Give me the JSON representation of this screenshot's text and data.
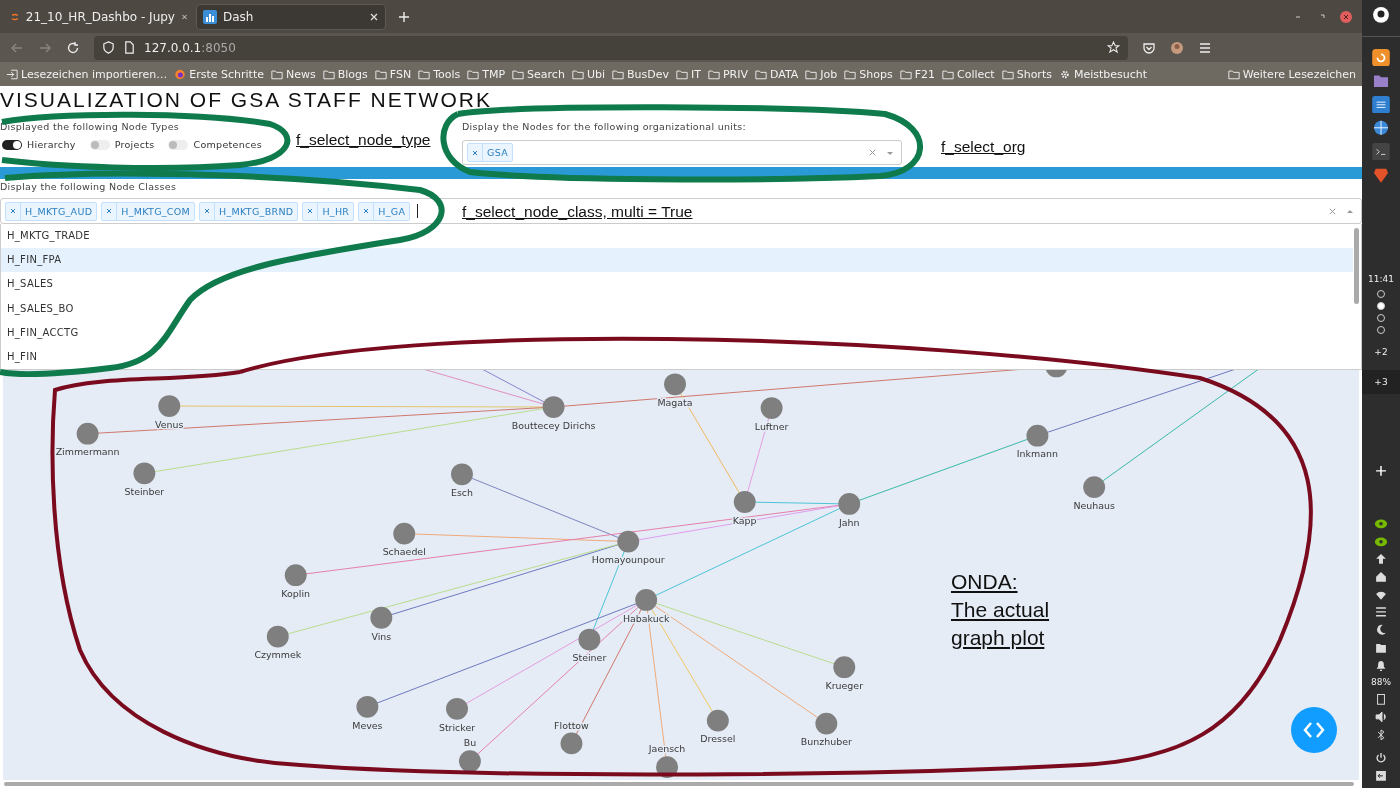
{
  "browser": {
    "tabs": [
      {
        "title": "21_10_HR_Dashbo - Jupy",
        "kind": "jupyter",
        "selected": false
      },
      {
        "title": "Dash",
        "kind": "dash",
        "selected": true
      }
    ],
    "url": {
      "host": "127.0.0.1",
      "port": ":8050"
    },
    "bookmarks": [
      {
        "label": "Lesezeichen importieren…",
        "kind": "import"
      },
      {
        "label": "Erste Schritte",
        "kind": "firefox"
      },
      {
        "label": "News",
        "kind": "folder"
      },
      {
        "label": "Blogs",
        "kind": "folder"
      },
      {
        "label": "FSN",
        "kind": "folder"
      },
      {
        "label": "Tools",
        "kind": "folder"
      },
      {
        "label": "TMP",
        "kind": "folder"
      },
      {
        "label": "Search",
        "kind": "folder"
      },
      {
        "label": "Ubi",
        "kind": "folder"
      },
      {
        "label": "BusDev",
        "kind": "folder"
      },
      {
        "label": "IT",
        "kind": "folder"
      },
      {
        "label": "PRIV",
        "kind": "folder"
      },
      {
        "label": "DATA",
        "kind": "folder"
      },
      {
        "label": "Job",
        "kind": "folder"
      },
      {
        "label": "Shops",
        "kind": "folder"
      },
      {
        "label": "F21",
        "kind": "folder"
      },
      {
        "label": "Collect",
        "kind": "folder"
      },
      {
        "label": "Shorts",
        "kind": "folder"
      },
      {
        "label": "Meistbesucht",
        "kind": "gear"
      }
    ],
    "other_bookmarks": "Weitere Lesezeichen"
  },
  "page": {
    "title": "VISUALIZATION OF GSA STAFF NETWORK",
    "node_types": {
      "label": "Displayed the following Node Types",
      "options": [
        {
          "label": "Hierarchy",
          "on": true
        },
        {
          "label": "Projects",
          "on": false
        },
        {
          "label": "Competences",
          "on": false
        }
      ]
    },
    "org": {
      "label": "Display the Nodes for the following organizational units:",
      "chips": [
        "GSA"
      ]
    },
    "node_classes": {
      "label": "Display the following Node Classes",
      "chips": [
        "H_MKTG_AUD",
        "H_MKTG_COM",
        "H_MKTG_BRND",
        "H_HR",
        "H_GA"
      ],
      "options": [
        {
          "label": "H_MKTG_TRADE",
          "selected": false
        },
        {
          "label": "H_FIN_FPA",
          "selected": true
        },
        {
          "label": "H_SALES",
          "selected": false
        },
        {
          "label": "H_SALES_BO",
          "selected": false
        },
        {
          "label": "H_FIN_ACCTG",
          "selected": false
        },
        {
          "label": "H_FIN",
          "selected": false
        }
      ]
    },
    "graph": {
      "nodes": [
        {
          "label": "Magata"
        },
        {
          "label": "Venus"
        },
        {
          "label": "Bouttecey Dirichs"
        },
        {
          "label": "Luftner"
        },
        {
          "label": "Zimmermann"
        },
        {
          "label": "Inkmann"
        },
        {
          "label": "Steinber"
        },
        {
          "label": "Esch"
        },
        {
          "label": "Neuhaus"
        },
        {
          "label": "Kapp"
        },
        {
          "label": "Jahn"
        },
        {
          "label": "Schaedel"
        },
        {
          "label": "Homayounpour"
        },
        {
          "label": "Koplin"
        },
        {
          "label": "Habakuck"
        },
        {
          "label": "Vins"
        },
        {
          "label": "Czymmek"
        },
        {
          "label": "Steiner"
        },
        {
          "label": "Krueger"
        },
        {
          "label": "Meves"
        },
        {
          "label": "Stricker"
        },
        {
          "label": "Dressel"
        },
        {
          "label": "Bunzhuber"
        },
        {
          "label": "Flottow"
        },
        {
          "label": "Bu"
        },
        {
          "label": "Jaensch"
        }
      ]
    }
  },
  "annotations": {
    "node_type": "f_select_node_type",
    "org": "f_select_org",
    "node_class": "f_select_node_class, multi = True",
    "plot": [
      "ONDA:",
      "The actual",
      "graph plot"
    ]
  },
  "system_panel": {
    "clock": "11:41",
    "workspaces": [
      {
        "selected": false
      },
      {
        "selected": true
      },
      {
        "selected": false
      },
      {
        "selected": false
      }
    ],
    "extra_workspaces": [
      "+2",
      "+3"
    ],
    "battery": "88%"
  }
}
